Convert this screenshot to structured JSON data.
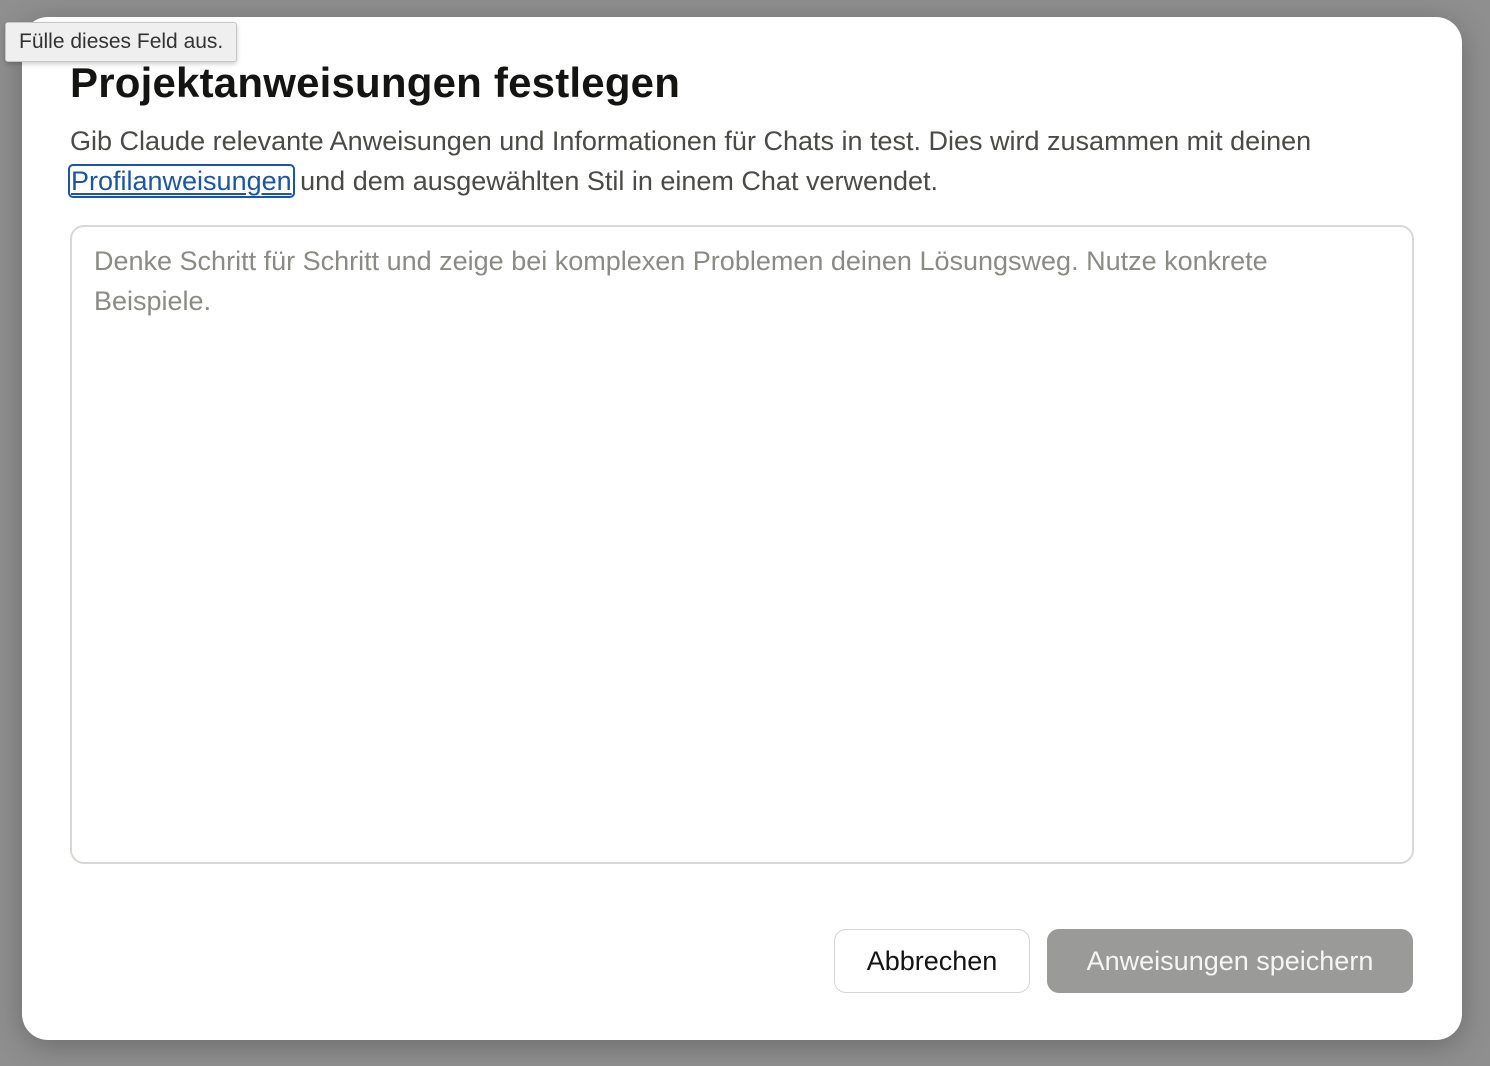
{
  "tooltip": {
    "text": "Fülle dieses Feld aus."
  },
  "dialog": {
    "title": "Projektanweisungen festlegen",
    "description_before": "Gib Claude relevante Anweisungen und Informationen für Chats in test. Dies wird zusammen mit deinen ",
    "description_link": "Profilanweisungen",
    "description_after": " und dem ausgewählten Stil in einem Chat verwendet.",
    "instructions_input": {
      "value": "",
      "placeholder": "Denke Schritt für Schritt und zeige bei komplexen Problemen deinen Lösungsweg. Nutze konkrete Beispiele."
    },
    "buttons": {
      "cancel_label": "Abbrechen",
      "save_label": "Anweisungen speichern"
    }
  },
  "colors": {
    "link": "#1a56a8",
    "save_button_disabled": "#9a9a98",
    "overlay": "#8f8f8f"
  }
}
